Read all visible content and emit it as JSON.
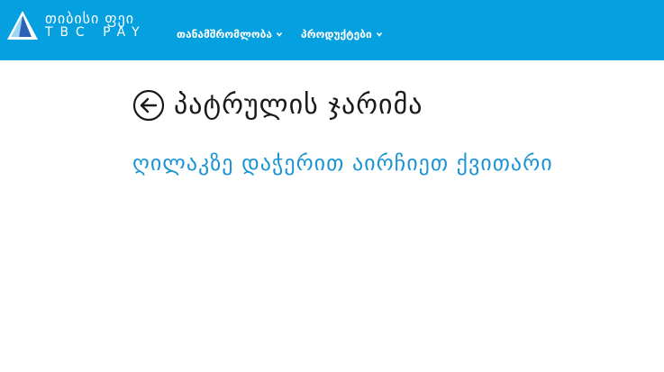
{
  "header": {
    "brand_geo": "თიბისი ფეი",
    "brand_lat": "TBC PAY",
    "logo_icon": "tbc-triangle-logo-icon",
    "nav": [
      {
        "label": "თანამშრომლობა",
        "icon": "chevron-down-icon"
      },
      {
        "label": "პროდუქტები",
        "icon": "chevron-down-icon"
      }
    ],
    "background": "#05a0e0"
  },
  "main": {
    "back_icon": "arrow-left-circle-icon",
    "title": "პატრულის ჯარიმა",
    "link": "ღილაკზე დაჭერით აირჩიეთ ქვითარი",
    "link_color": "#1c94d2"
  }
}
